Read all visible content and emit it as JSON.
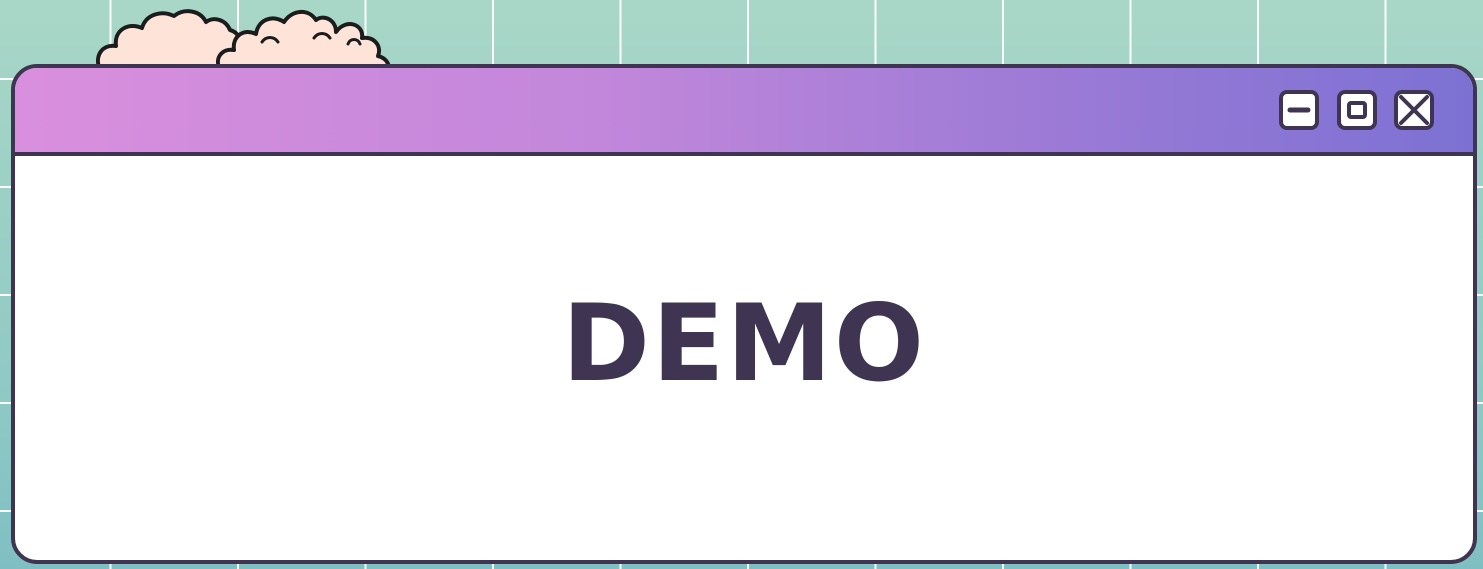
{
  "colors": {
    "background_teal": "#a9d6c6",
    "grid_line": "#ffffff",
    "window_border": "#3f3552",
    "titlebar_gradient_start": "#d98fdd",
    "titlebar_gradient_end": "#7c71d3",
    "cloud_fill": "#fde3d8",
    "text": "#3f3552"
  },
  "window": {
    "controls": [
      {
        "name": "minimize",
        "icon": "minimize-icon"
      },
      {
        "name": "maximize",
        "icon": "maximize-icon"
      },
      {
        "name": "close",
        "icon": "close-icon"
      }
    ],
    "content": {
      "title": "DEMO"
    }
  },
  "decorations": {
    "clouds": "cloud-decoration"
  }
}
